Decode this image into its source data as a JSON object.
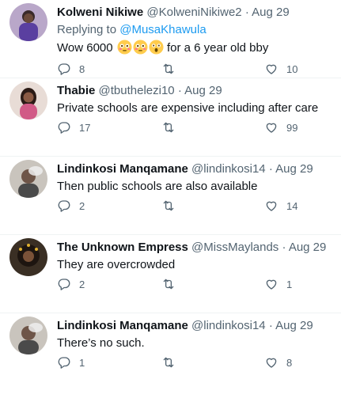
{
  "tweets": [
    {
      "name": "Kolweni Nikiwe",
      "handle": "@KolweniNikiwe2",
      "date": "Aug 29",
      "replying_prefix": "Replying to ",
      "replying_to": "@MusaKhawula",
      "text_before": "Wow 6000 ",
      "emojis": [
        "flushed-face",
        "flushed-face",
        "astonished-face"
      ],
      "text_after": "for a 6 year old bby",
      "replies": "8",
      "retweets": "",
      "likes": "10"
    },
    {
      "name": "Thabie",
      "handle": "@tbuthelezi10",
      "date": "Aug 29",
      "text": "Private schools are expensive including after care",
      "replies": "17",
      "retweets": "",
      "likes": "99"
    },
    {
      "name": "Lindinkosi Manqamane",
      "handle": "@lindinkosi14",
      "date": "Aug 29",
      "text": "Then public schools are also available",
      "replies": "2",
      "retweets": "",
      "likes": "14"
    },
    {
      "name": "The Unknown Empress",
      "handle": "@MissMaylands",
      "date": "Aug 29",
      "text": "They are overcrowded",
      "replies": "2",
      "retweets": "",
      "likes": "1"
    },
    {
      "name": "Lindinkosi Manqamane",
      "handle": "@lindinkosi14",
      "date": "Aug 29",
      "text": "There’s no such.",
      "replies": "1",
      "retweets": "",
      "likes": "8"
    }
  ],
  "separator": "·",
  "colors": {
    "accent": "#1d9bf0",
    "muted": "#536471",
    "text": "#0f1419"
  },
  "icons": {
    "reply": "reply-icon",
    "retweet": "retweet-icon",
    "like": "heart-icon"
  }
}
